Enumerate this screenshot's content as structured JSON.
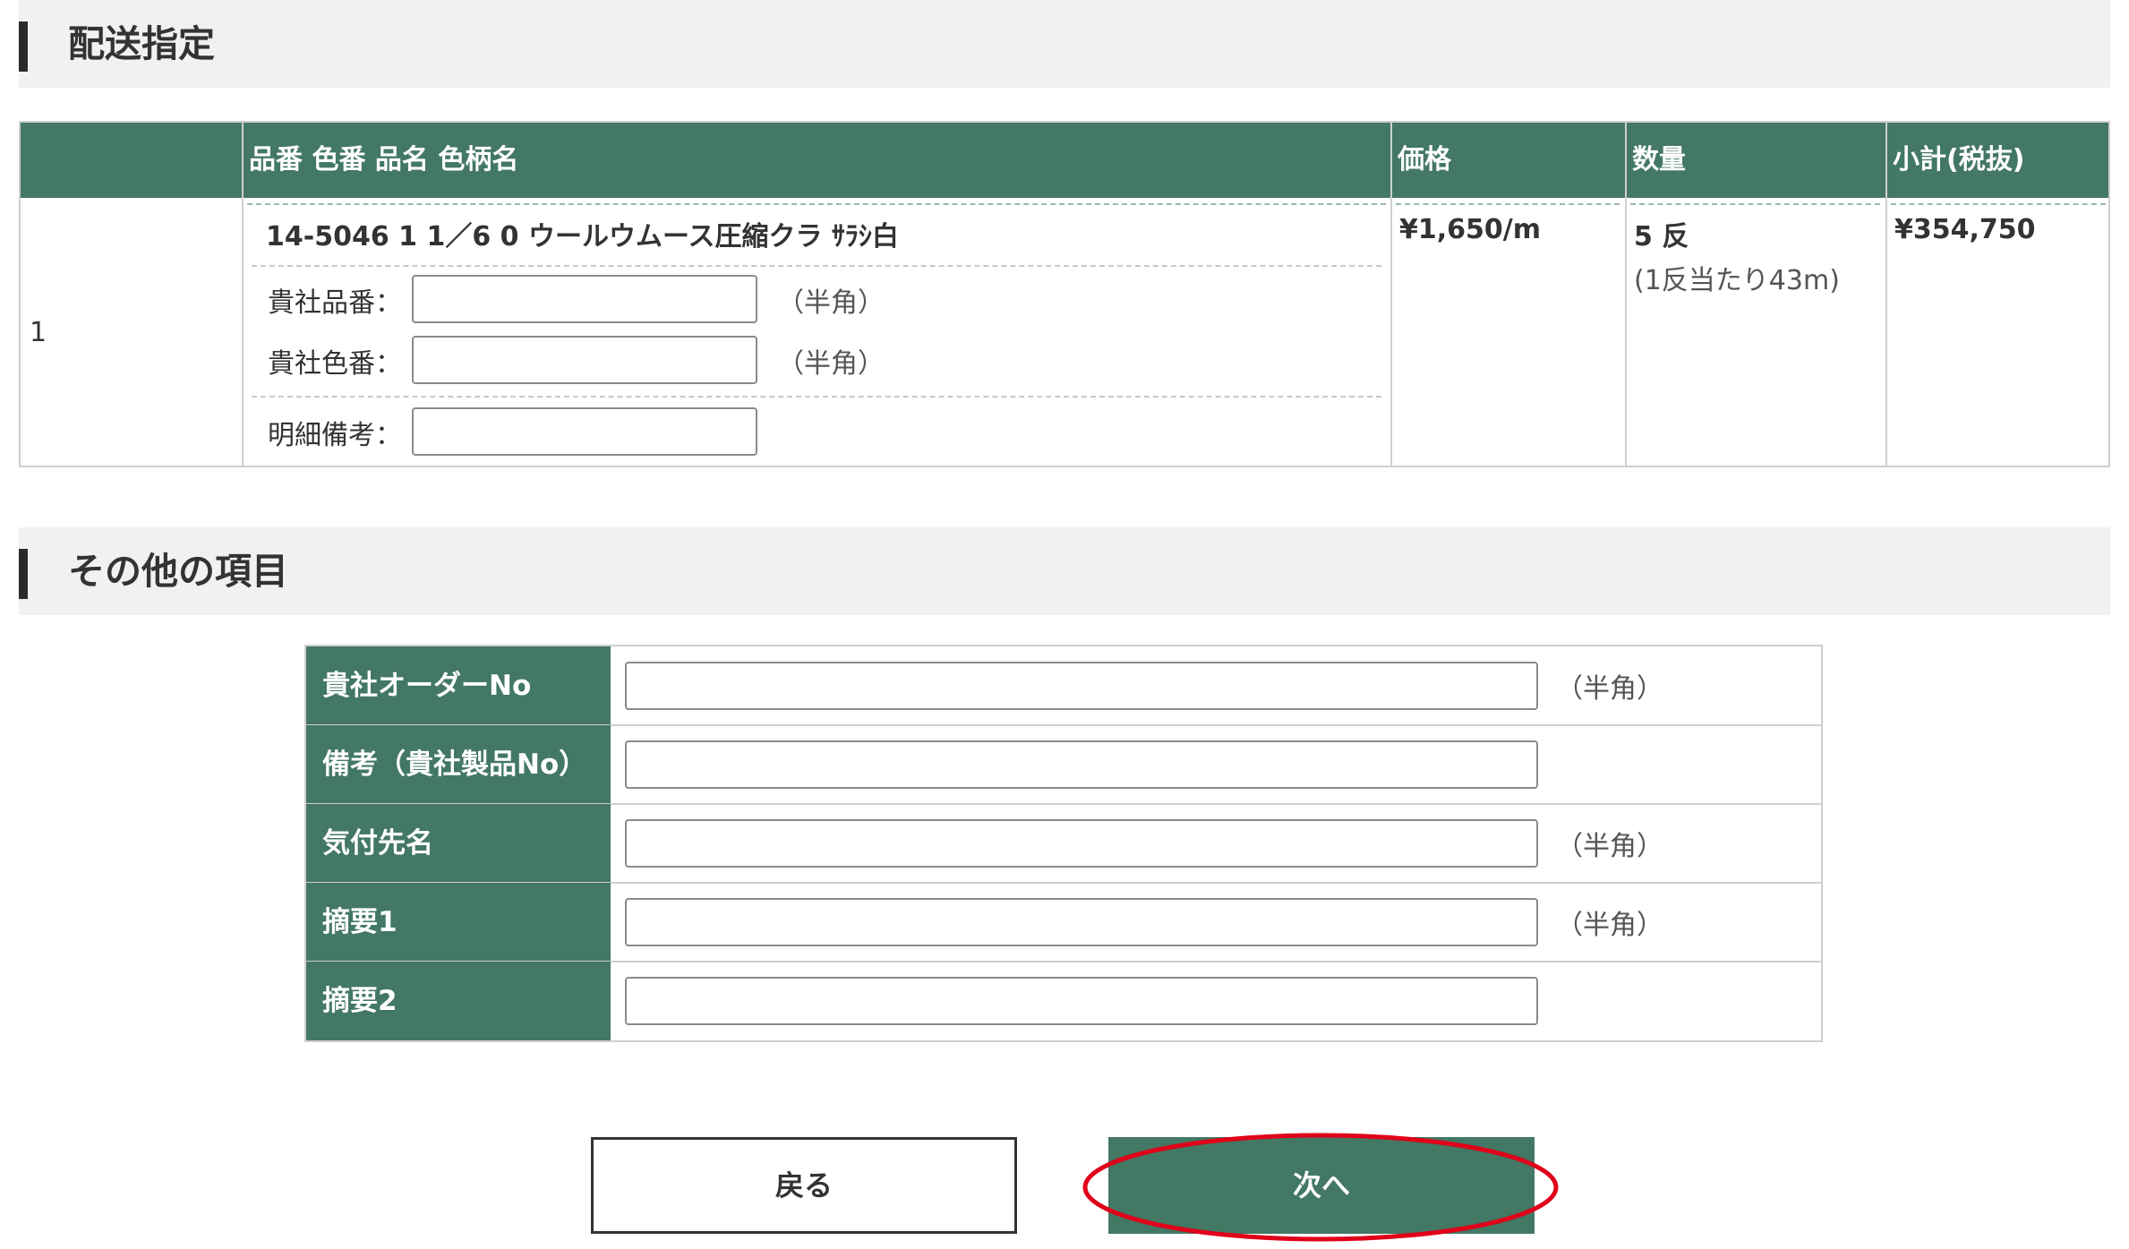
{
  "section1": {
    "title": "配送指定"
  },
  "order_table": {
    "headers": [
      "",
      "品番 色番 品名 色柄名",
      "価格",
      "数量",
      "小計(税抜)"
    ],
    "row": {
      "index": "1",
      "product": "14-5046 1 1／6 0 ウールウムース圧縮クラ ｻﾗｼ白",
      "customer_part_label": "貴社品番：",
      "customer_part_value": "",
      "customer_part_note": "（半角）",
      "customer_color_label": "貴社色番：",
      "customer_color_value": "",
      "customer_color_note": "（半角）",
      "detail_remarks_label": "明細備考：",
      "detail_remarks_value": "",
      "price": "¥1,650/m",
      "quantity": "5 反",
      "quantity_note": "(1反当たり43m)",
      "subtotal": "¥354,750"
    }
  },
  "section2": {
    "title": "その他の項目"
  },
  "other_items": [
    {
      "label": "貴社オーダーNo",
      "value": "",
      "note": "（半角）"
    },
    {
      "label": "備考（貴社製品No）",
      "value": "",
      "note": ""
    },
    {
      "label": "気付先名",
      "value": "",
      "note": "（半角）"
    },
    {
      "label": "摘要1",
      "value": "",
      "note": "（半角）"
    },
    {
      "label": "摘要2",
      "value": "",
      "note": ""
    }
  ],
  "buttons": {
    "back": "戻る",
    "next": "次へ"
  },
  "colors": {
    "header_green": "#437864",
    "highlight_red": "#e0001a"
  }
}
